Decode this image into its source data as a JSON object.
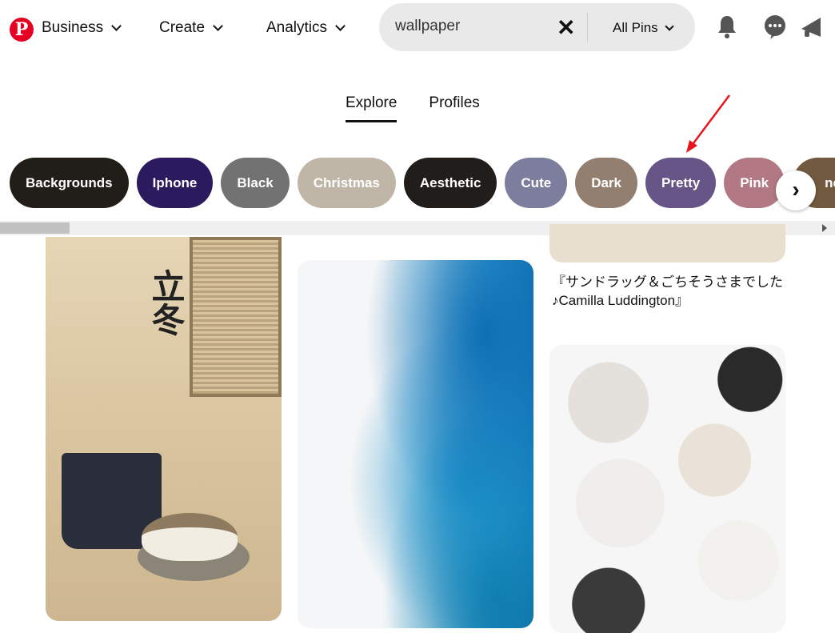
{
  "header": {
    "logo": "P",
    "nav": [
      "Business",
      "Create",
      "Analytics"
    ],
    "search_value": "wallpaper",
    "search_scope": "All Pins",
    "icons": [
      "bell-icon",
      "chat-icon",
      "megaphone-icon"
    ]
  },
  "tabs": [
    {
      "label": "Explore",
      "active": true
    },
    {
      "label": "Profiles",
      "active": false
    }
  ],
  "pills": [
    {
      "label": "Backgrounds",
      "color": "#211d18"
    },
    {
      "label": "Iphone",
      "color": "#2c1a5e"
    },
    {
      "label": "Black",
      "color": "#727272"
    },
    {
      "label": "Christmas",
      "color": "#c0b6a7"
    },
    {
      "label": "Aesthetic",
      "color": "#201d1a"
    },
    {
      "label": "Cute",
      "color": "#7d7d9d"
    },
    {
      "label": "Dark",
      "color": "#937f6f"
    },
    {
      "label": "Pretty",
      "color": "#675587"
    },
    {
      "label": "Pink",
      "color": "#b27883"
    },
    {
      "label": "ne",
      "color": "#715a40"
    }
  ],
  "pins": {
    "caption": "『サンドラッグ＆ごちそうさまでした♪Camilla Luddington』"
  },
  "annotation": {
    "arrow_color": "#e8141b"
  }
}
